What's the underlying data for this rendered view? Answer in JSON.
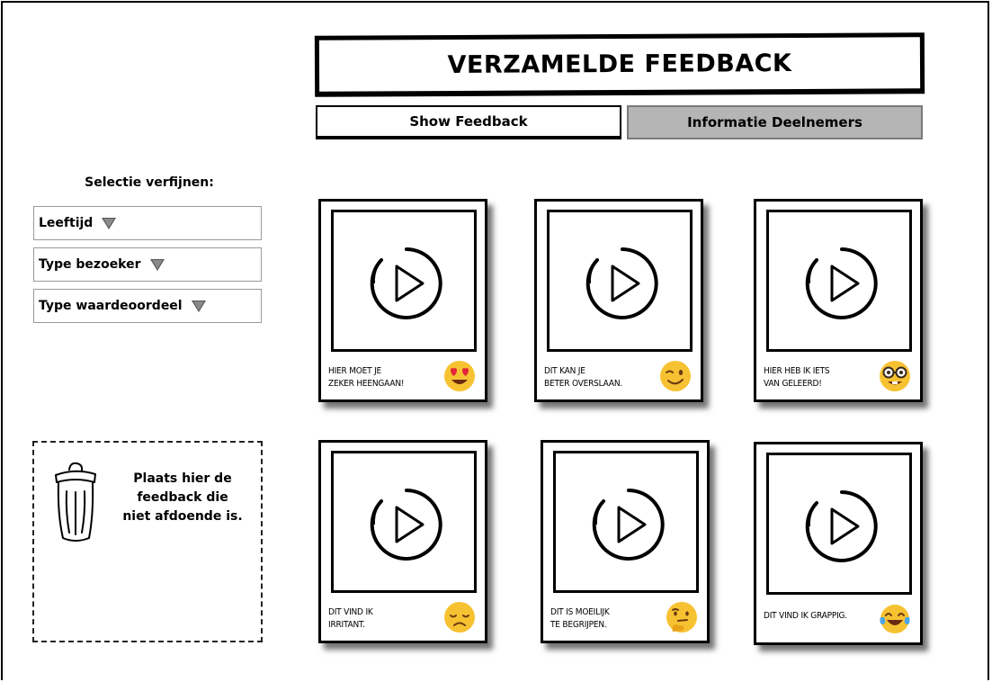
{
  "page": {
    "title": "VERZAMELDE FEEDBACK"
  },
  "tabs": [
    {
      "label": "Show Feedback",
      "active": true
    },
    {
      "label": "Informatie Deelnemers",
      "active": false
    }
  ],
  "filters": {
    "heading": "Selectie verfijnen:",
    "dropdowns": [
      {
        "label": "Leeftijd"
      },
      {
        "label": "Type bezoeker"
      },
      {
        "label": "Type waardeoordeel"
      }
    ]
  },
  "trash": {
    "icon": "trash-can-icon",
    "text_lines": [
      "Plaats hier de",
      "feedback die",
      "niet afdoende is."
    ]
  },
  "cards": [
    {
      "caption_lines": [
        "Hier moet je",
        "zeker heengaan!"
      ],
      "emoji": "heart-eyes-emoji"
    },
    {
      "caption_lines": [
        "Dit kan je",
        "beter overslaan."
      ],
      "emoji": "winking-face-emoji"
    },
    {
      "caption_lines": [
        "Hier heb ik iets",
        "van geleerd!"
      ],
      "emoji": "nerd-face-emoji"
    },
    {
      "caption_lines": [
        "Dit vind ik",
        "irritant."
      ],
      "emoji": "disappointed-face-emoji"
    },
    {
      "caption_lines": [
        "Dit is moeilijk",
        "te begrijpen."
      ],
      "emoji": "thinking-face-emoji"
    },
    {
      "caption_lines": [
        "Dit vind ik grappig."
      ],
      "emoji": "tears-of-joy-emoji"
    }
  ],
  "colors": {
    "inactive_tab": "#b5b5b5",
    "emoji_yellow": "#f7c232"
  }
}
